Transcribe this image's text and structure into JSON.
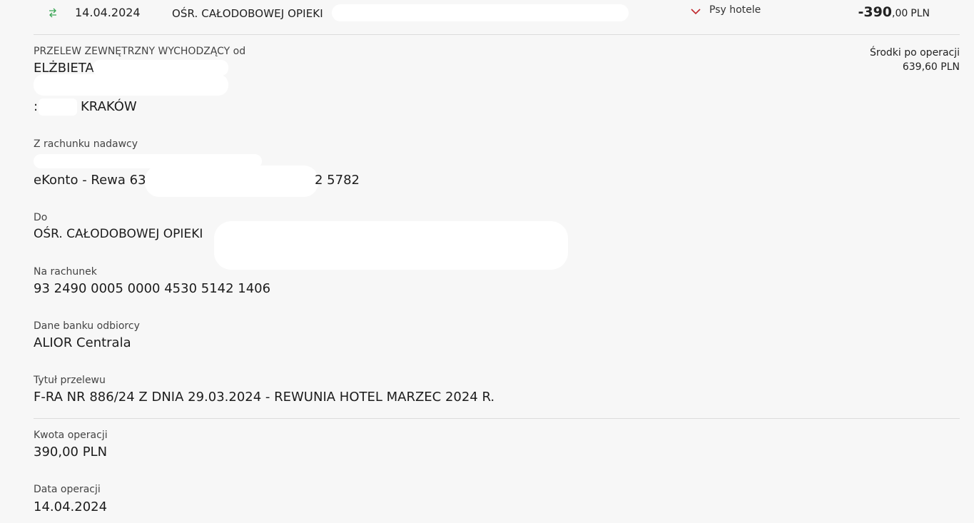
{
  "transaction": {
    "date": "14.04.2024",
    "title": "OŚR. CAŁODOBOWEJ OPIEKI",
    "category": "Psy hotele",
    "amount_int": "-390",
    "amount_dec": ",00",
    "amount_currency": "PLN",
    "icon_transfer": "transfer-arrows-icon",
    "icon_category": "chevron-down-icon",
    "color_transfer_icon": "#3aa655",
    "color_category_icon": "#c0282d"
  },
  "details": {
    "type_label": "PRZELEW ZEWNĘTRZNY WYCHODZĄCY od",
    "sender_name": "ELŻBIETA",
    "sender_city": "KRAKÓW",
    "sender_city_prefix": ":",
    "balance_label": "Środki po operacji",
    "balance_value": "639,60 PLN",
    "from_account_label": "Z rachunku nadawcy",
    "from_account_name": "eKonto - Rewa 63",
    "from_account_suffix": "2 5782",
    "to_label": "Do",
    "to_name": "OŚR. CAŁODOBOWEJ OPIEKI",
    "to_account_label": "Na rachunek",
    "to_account_value": "93 2490 0005 0000 4530 5142 1406",
    "bank_label": "Dane banku odbiorcy",
    "bank_value": "ALIOR Centrala",
    "title_label": "Tytuł przelewu",
    "title_value": "F-RA NR 886/24 Z DNIA 29.03.2024 - REWUNIA HOTEL MARZEC 2024 R.",
    "amount_label": "Kwota operacji",
    "amount_value": "390,00 PLN",
    "date_label": "Data operacji",
    "date_value": "14.04.2024"
  }
}
